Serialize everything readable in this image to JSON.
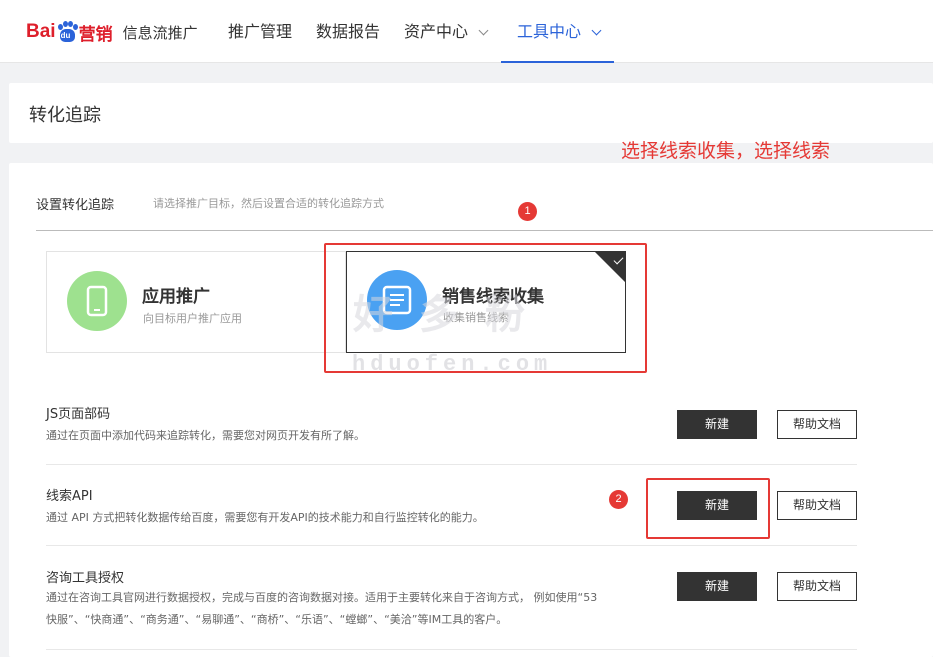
{
  "brand": {
    "logo_text": "Bai",
    "logo_paw_text": "du",
    "logo_suffix": "营销",
    "product_name": "信息流推广"
  },
  "nav": {
    "items": [
      {
        "label": "推广管理"
      },
      {
        "label": "数据报告"
      },
      {
        "label": "资产中心"
      },
      {
        "label": "工具中心"
      }
    ],
    "active": "工具中心"
  },
  "page": {
    "title": "转化追踪"
  },
  "annotations": {
    "top_note": "选择线索收集，选择线索",
    "step1": "1",
    "step2": "2",
    "color": "#e53935"
  },
  "setup": {
    "label": "设置转化追踪",
    "hint": "请选择推广目标，然后设置合适的转化追踪方式"
  },
  "goals": [
    {
      "title": "应用推广",
      "subtitle": "向目标用户推广应用",
      "icon": "mobile-phone-icon",
      "selected": false
    },
    {
      "title": "销售线索收集",
      "subtitle": "收集销售线索",
      "icon": "document-list-icon",
      "selected": true
    }
  ],
  "watermark": {
    "text_cn": "好多粉",
    "text_en": "hduofen.com"
  },
  "methods": [
    {
      "title": "JS页面部码",
      "desc": "通过在页面中添加代码来追踪转化，需要您对网页开发有所了解。",
      "new_label": "新建",
      "help_label": "帮助文档"
    },
    {
      "title": "线索API",
      "desc": "通过 API 方式把转化数据传给百度，需要您有开发API的技术能力和自行监控转化的能力。",
      "new_label": "新建",
      "help_label": "帮助文档"
    },
    {
      "title": "咨询工具授权",
      "desc": "通过在咨询工具官网进行数据授权，完成与百度的咨询数据对接。适用于主要转化来自于咨询方式， 例如使用“53",
      "desc2": "快服”、“快商通”、“商务通”、“易聊通”、“商桥”、“乐语”、“螳螂”、“美洽”等IM工具的客户。",
      "new_label": "新建",
      "help_label": "帮助文档"
    }
  ],
  "colors": {
    "accent": "#2b63d9",
    "brand_red": "#de1f2b",
    "dark_button": "#333333",
    "app_icon_bg": "#9ee18f",
    "leads_icon_bg": "#4aa1f2"
  }
}
